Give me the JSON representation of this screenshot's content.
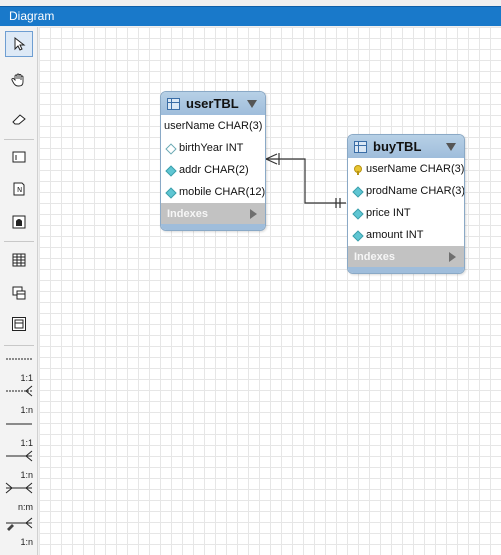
{
  "window": {
    "title": "Diagram"
  },
  "toolbar": {
    "tools": [
      {
        "name": "pointer-icon"
      },
      {
        "name": "hand-icon"
      },
      {
        "name": "eraser-icon"
      },
      {
        "name": "layer-icon"
      },
      {
        "name": "note-icon"
      },
      {
        "name": "image-icon"
      },
      {
        "name": "table-icon"
      },
      {
        "name": "view-icon"
      },
      {
        "name": "routine-group-icon"
      }
    ],
    "relationships": [
      {
        "name": "rel-1-1-non-identifying",
        "label": "1:1"
      },
      {
        "name": "rel-1-n-non-identifying",
        "label": "1:n"
      },
      {
        "name": "rel-1-1-identifying",
        "label": "1:1"
      },
      {
        "name": "rel-1-n-identifying",
        "label": "1:n"
      },
      {
        "name": "rel-n-m",
        "label": "n:m"
      },
      {
        "name": "rel-1-n-existing-columns",
        "label": "1:n"
      }
    ]
  },
  "tables": [
    {
      "name": "userTBL",
      "columns": [
        {
          "text": "userName CHAR(3)",
          "marker": "none"
        },
        {
          "text": "birthYear INT",
          "marker": "diamond-empty"
        },
        {
          "text": "addr CHAR(2)",
          "marker": "diamond-filled"
        },
        {
          "text": "mobile CHAR(12)",
          "marker": "diamond-filled"
        }
      ],
      "indexes_label": "Indexes"
    },
    {
      "name": "buyTBL",
      "columns": [
        {
          "text": "userName CHAR(3)",
          "marker": "key"
        },
        {
          "text": "prodName CHAR(3)",
          "marker": "diamond-filled"
        },
        {
          "text": "price INT",
          "marker": "diamond-filled"
        },
        {
          "text": "amount INT",
          "marker": "diamond-filled"
        }
      ],
      "indexes_label": "Indexes"
    }
  ],
  "colors": {
    "titlebar": "#1979ca",
    "table_header": "#9fbddb",
    "indexes_bar": "#c2c2c2"
  }
}
